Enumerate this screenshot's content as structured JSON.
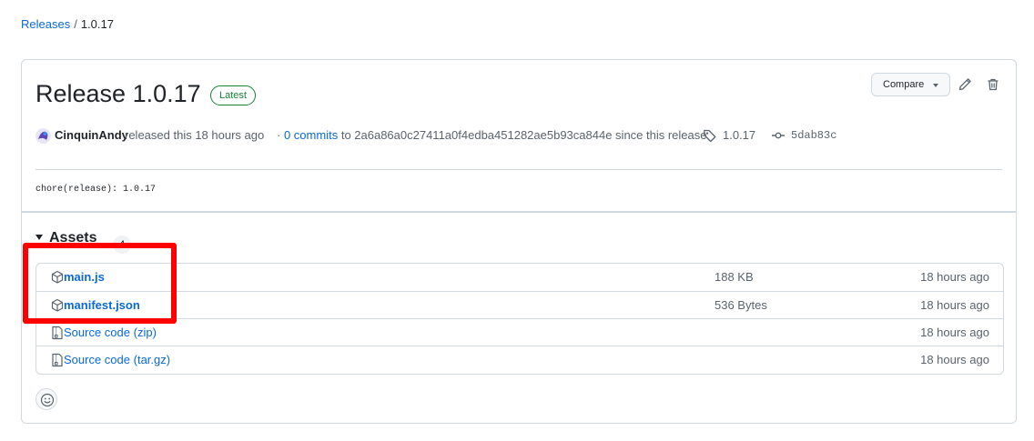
{
  "breadcrumb": {
    "root": "Releases",
    "separator": "/",
    "current": "1.0.17"
  },
  "release": {
    "title": "Release 1.0.17",
    "badge": "Latest",
    "author": "CinquinAndy",
    "released_text": "released this 18 hours ago",
    "commits_prefix": "·",
    "commits_link": "0 commits",
    "commits_suffix": "to 2a6a86a0c27411a0f4edba451282ae5b93ca844e since this release",
    "tag": "1.0.17",
    "commit_sha": "5dab83c",
    "body": "chore(release): 1.0.17"
  },
  "toolbar": {
    "compare_label": "Compare"
  },
  "assets": {
    "header": "Assets",
    "count": "4",
    "items": [
      {
        "name": "main.js",
        "suffix": "",
        "size": "188 KB",
        "time": "18 hours ago",
        "icon": "package-icon"
      },
      {
        "name": "manifest.json",
        "suffix": "",
        "size": "536 Bytes",
        "time": "18 hours ago",
        "icon": "package-icon"
      },
      {
        "name": "Source code",
        "suffix": "(zip)",
        "size": "",
        "time": "18 hours ago",
        "icon": "file-zip-icon"
      },
      {
        "name": "Source code",
        "suffix": "(tar.gz)",
        "size": "",
        "time": "18 hours ago",
        "icon": "file-zip-icon"
      }
    ]
  },
  "colors": {
    "link": "#0969da",
    "badge_green": "#1a7f37",
    "highlight": "#ff0000"
  }
}
